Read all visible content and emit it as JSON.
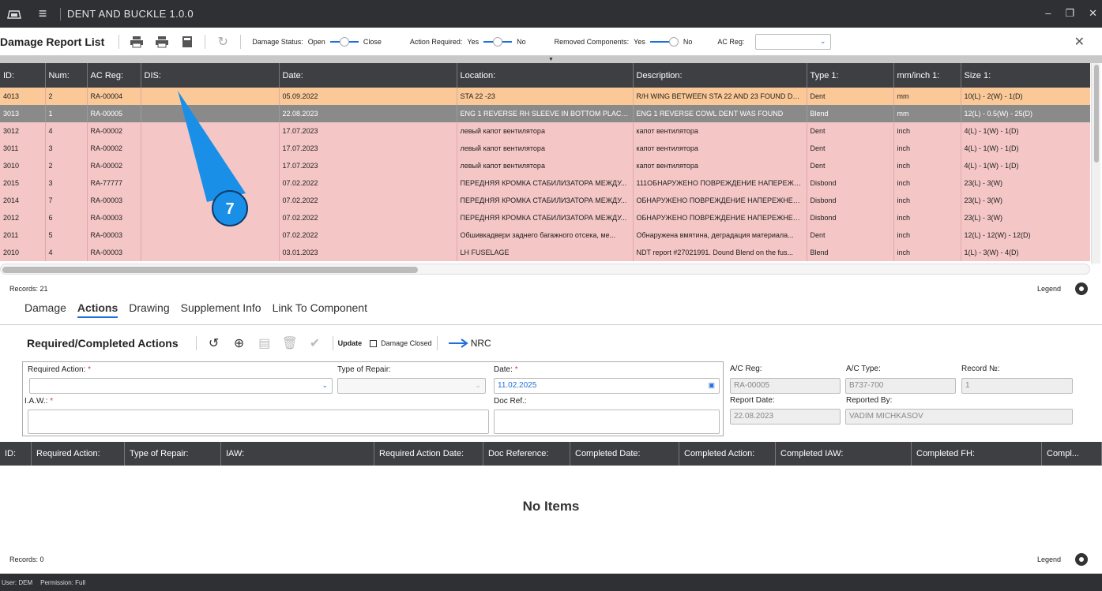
{
  "app": {
    "title": "DENT AND BUCKLE 1.0.0"
  },
  "toolbar": {
    "title": "Damage Report List",
    "damage_status_label": "Damage Status:",
    "damage_status_left": "Open",
    "damage_status_right": "Close",
    "action_required_label": "Action Required:",
    "action_required_left": "Yes",
    "action_required_right": "No",
    "removed_components_label": "Removed Components:",
    "removed_components_left": "Yes",
    "removed_components_right": "No",
    "ac_reg_label": "AC Reg:",
    "ac_reg_value": ""
  },
  "damage_table": {
    "headers": [
      "ID:",
      "Num:",
      "AC Reg:",
      "DIS:",
      "Date:",
      "Location:",
      "Description:",
      "Type 1:",
      "mm/inch 1:",
      "Size 1:"
    ],
    "rows": [
      [
        "4013",
        "2",
        "RA-00004",
        "",
        "05.09.2022",
        "STA 22 -23",
        "R/H WING BETWEEN STA 22 AND 23 FOUND DE...",
        "Dent",
        "mm",
        "10(L) - 2(W) - 1(D)"
      ],
      [
        "3013",
        "1",
        "RA-00005",
        "",
        "22.08.2023",
        "ENG 1 REVERSE RH SLEEVE IN BOTTOM PLACE...",
        "ENG 1 REVERSE COWL DENT WAS FOUND",
        "Blend",
        "mm",
        "12(L) - 0.5(W) - 25(D)"
      ],
      [
        "3012",
        "4",
        "RA-00002",
        "",
        "17.07.2023",
        "левый капот вентилятора",
        "капот вентилятора",
        "Dent",
        "inch",
        "4(L) - 1(W) - 1(D)"
      ],
      [
        "3011",
        "3",
        "RA-00002",
        "",
        "17.07.2023",
        "левый капот вентилятора",
        "капот вентилятора",
        "Dent",
        "inch",
        "4(L) - 1(W) - 1(D)"
      ],
      [
        "3010",
        "2",
        "RA-00002",
        "",
        "17.07.2023",
        "левый капот вентилятора",
        "капот вентилятора",
        "Dent",
        "inch",
        "4(L) - 1(W) - 1(D)"
      ],
      [
        "2015",
        "3",
        "RA-77777",
        "",
        "07.02.2022",
        "ПЕРЕДНЯЯ КРОМКА СТАБИЛИЗАТОРА МЕЖДУ...",
        "111ОБНАРУЖЕНО ПОВРЕЖДЕНИЕ НАПЕРЕЖН...",
        "Disbond",
        "inch",
        "23(L) - 3(W)"
      ],
      [
        "2014",
        "7",
        "RA-00003",
        "",
        "07.02.2022",
        "ПЕРЕДНЯЯ КРОМКА СТАБИЛИЗАТОРА МЕЖДУ...",
        "ОБНАРУЖЕНО ПОВРЕЖДЕНИЕ НАПЕРЕЖНЕЙ...",
        "Disbond",
        "inch",
        "23(L) - 3(W)"
      ],
      [
        "2012",
        "6",
        "RA-00003",
        "",
        "07.02.2022",
        "ПЕРЕДНЯЯ КРОМКА СТАБИЛИЗАТОРА МЕЖДУ...",
        "ОБНАРУЖЕНО ПОВРЕЖДЕНИЕ НАПЕРЕЖНЕЙ...",
        "Disbond",
        "inch",
        "23(L) - 3(W)"
      ],
      [
        "2011",
        "5",
        "RA-00003",
        "",
        "07.02.2022",
        "Обшивкадвери заднего багажного отсека, ме...",
        "Обнаружена вмятина,  деградация материала...",
        "Dent",
        "inch",
        "12(L) - 12(W) - 12(D)"
      ],
      [
        "2010",
        "4",
        "RA-00003",
        "",
        "03.01.2023",
        "LH FUSELAGE",
        "NDT report #27021991. Dound Blend on the fus...",
        "Blend",
        "inch",
        "1(L) - 3(W) - 4(D)"
      ]
    ],
    "records": "Records: 21",
    "legend": "Legend"
  },
  "callout": {
    "number": "7",
    "color": "#1a8fe8"
  },
  "tabs": [
    "Damage",
    "Actions",
    "Drawing",
    "Supplement Info",
    "Link To Component"
  ],
  "actions": {
    "title": "Required/Completed Actions",
    "update": "Update",
    "damage_closed": "Damage Closed",
    "nrc": "NRC",
    "required_action_label": "Required Action:",
    "type_of_repair_label": "Type of Repair:",
    "date_label": "Date:",
    "date_value": "11.02.2025",
    "iaw_label": "I.A.W.:",
    "doc_ref_label": "Doc Ref.:",
    "req_mark": "*",
    "ac_reg_label": "A/C Reg:",
    "ac_reg_value": "RA-00005",
    "ac_type_label": "A/C Type:",
    "ac_type_value": "B737-700",
    "record_no_label": "Record №:",
    "record_no_value": "1",
    "report_date_label": "Report Date:",
    "report_date_value": "22.08.2023",
    "reported_by_label": "Reported By:",
    "reported_by_value": "VADIM MICHKASOV"
  },
  "actions_table": {
    "headers": [
      "ID:",
      "Required Action:",
      "Type of Repair:",
      "IAW:",
      "Required Action Date:",
      "Doc Reference:",
      "Completed Date:",
      "Completed Action:",
      "Completed IAW:",
      "Completed FH:",
      "Compl..."
    ],
    "empty": "No Items",
    "records": "Records: 0",
    "legend": "Legend"
  },
  "status": {
    "user": "User: DEM",
    "permission": "Permission: Full"
  },
  "colors": {
    "accent": "#1e6fd9",
    "row_selected": "#fbc897",
    "row_gray": "#8a8a8a",
    "row_pink": "#f4c6c6",
    "header": "#3d3f43"
  }
}
